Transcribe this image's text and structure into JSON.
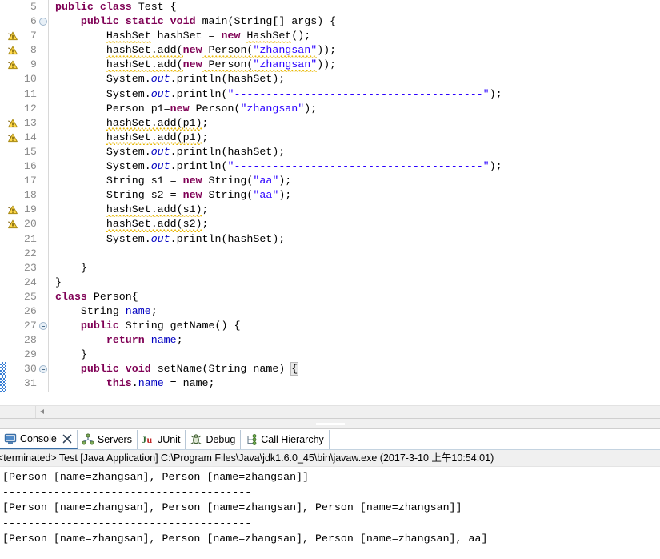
{
  "editor": {
    "language": "java",
    "first_visible_line": 5,
    "lines": [
      {
        "num": 5,
        "marker": "none",
        "fold": "none",
        "change": false,
        "tokens": [
          {
            "t": "public",
            "c": "kw"
          },
          {
            "t": " ",
            "c": "plain"
          },
          {
            "t": "class",
            "c": "kw"
          },
          {
            "t": " Test {",
            "c": "plain"
          }
        ]
      },
      {
        "num": 6,
        "marker": "none",
        "fold": "collapse",
        "change": false,
        "tokens": [
          {
            "t": "    ",
            "c": "plain"
          },
          {
            "t": "public",
            "c": "kw"
          },
          {
            "t": " ",
            "c": "plain"
          },
          {
            "t": "static",
            "c": "kw"
          },
          {
            "t": " ",
            "c": "plain"
          },
          {
            "t": "void",
            "c": "kw"
          },
          {
            "t": " main(String[] args) {",
            "c": "plain"
          }
        ]
      },
      {
        "num": 7,
        "marker": "warning",
        "fold": "none",
        "change": false,
        "tokens": [
          {
            "t": "        ",
            "c": "plain"
          },
          {
            "t": "HashSet",
            "c": "plain",
            "sq": true
          },
          {
            "t": " hashSet = ",
            "c": "plain"
          },
          {
            "t": "new",
            "c": "kw"
          },
          {
            "t": " ",
            "c": "plain"
          },
          {
            "t": "HashSet",
            "c": "plain",
            "sq": true
          },
          {
            "t": "();",
            "c": "plain"
          }
        ]
      },
      {
        "num": 8,
        "marker": "warning",
        "fold": "none",
        "change": false,
        "tokens": [
          {
            "t": "        ",
            "c": "plain"
          },
          {
            "t": "hashSet.add(",
            "c": "plain",
            "sq": true
          },
          {
            "t": "new",
            "c": "kw"
          },
          {
            "t": " Person(",
            "c": "plain",
            "sq": true
          },
          {
            "t": "\"zhangsan\"",
            "c": "str",
            "sq": true
          },
          {
            "t": "));",
            "c": "plain"
          }
        ]
      },
      {
        "num": 9,
        "marker": "warning",
        "fold": "none",
        "change": false,
        "tokens": [
          {
            "t": "        ",
            "c": "plain"
          },
          {
            "t": "hashSet.add(",
            "c": "plain",
            "sq": true
          },
          {
            "t": "new",
            "c": "kw"
          },
          {
            "t": " Person(",
            "c": "plain",
            "sq": true
          },
          {
            "t": "\"zhangsan\"",
            "c": "str",
            "sq": true
          },
          {
            "t": "));",
            "c": "plain"
          }
        ]
      },
      {
        "num": 10,
        "marker": "none",
        "fold": "none",
        "change": false,
        "tokens": [
          {
            "t": "        System.",
            "c": "plain"
          },
          {
            "t": "out",
            "c": "fld-static"
          },
          {
            "t": ".println(hashSet);",
            "c": "plain"
          }
        ]
      },
      {
        "num": 11,
        "marker": "none",
        "fold": "none",
        "change": false,
        "tokens": [
          {
            "t": "        System.",
            "c": "plain"
          },
          {
            "t": "out",
            "c": "fld-static"
          },
          {
            "t": ".println(",
            "c": "plain"
          },
          {
            "t": "\"---------------------------------------\"",
            "c": "str"
          },
          {
            "t": ");",
            "c": "plain"
          }
        ]
      },
      {
        "num": 12,
        "marker": "none",
        "fold": "none",
        "change": false,
        "tokens": [
          {
            "t": "        Person p1=",
            "c": "plain"
          },
          {
            "t": "new",
            "c": "kw"
          },
          {
            "t": " Person(",
            "c": "plain"
          },
          {
            "t": "\"zhangsan\"",
            "c": "str"
          },
          {
            "t": ");",
            "c": "plain"
          }
        ]
      },
      {
        "num": 13,
        "marker": "warning",
        "fold": "none",
        "change": false,
        "tokens": [
          {
            "t": "        ",
            "c": "plain"
          },
          {
            "t": "hashSet.add(p1)",
            "c": "plain",
            "sq": true
          },
          {
            "t": ";",
            "c": "plain"
          }
        ]
      },
      {
        "num": 14,
        "marker": "warning",
        "fold": "none",
        "change": false,
        "tokens": [
          {
            "t": "        ",
            "c": "plain"
          },
          {
            "t": "hashSet.add(p1)",
            "c": "plain",
            "sq": true
          },
          {
            "t": ";",
            "c": "plain"
          }
        ]
      },
      {
        "num": 15,
        "marker": "none",
        "fold": "none",
        "change": false,
        "tokens": [
          {
            "t": "        System.",
            "c": "plain"
          },
          {
            "t": "out",
            "c": "fld-static"
          },
          {
            "t": ".println(hashSet);",
            "c": "plain"
          }
        ]
      },
      {
        "num": 16,
        "marker": "none",
        "fold": "none",
        "change": false,
        "tokens": [
          {
            "t": "        System.",
            "c": "plain"
          },
          {
            "t": "out",
            "c": "fld-static"
          },
          {
            "t": ".println(",
            "c": "plain"
          },
          {
            "t": "\"---------------------------------------\"",
            "c": "str"
          },
          {
            "t": ");",
            "c": "plain"
          }
        ]
      },
      {
        "num": 17,
        "marker": "none",
        "fold": "none",
        "change": false,
        "tokens": [
          {
            "t": "        String s1 = ",
            "c": "plain"
          },
          {
            "t": "new",
            "c": "kw"
          },
          {
            "t": " String(",
            "c": "plain"
          },
          {
            "t": "\"aa\"",
            "c": "str"
          },
          {
            "t": ");",
            "c": "plain"
          }
        ]
      },
      {
        "num": 18,
        "marker": "none",
        "fold": "none",
        "change": false,
        "tokens": [
          {
            "t": "        String s2 = ",
            "c": "plain"
          },
          {
            "t": "new",
            "c": "kw"
          },
          {
            "t": " String(",
            "c": "plain"
          },
          {
            "t": "\"aa\"",
            "c": "str"
          },
          {
            "t": ");",
            "c": "plain"
          }
        ]
      },
      {
        "num": 19,
        "marker": "warning",
        "fold": "none",
        "change": false,
        "tokens": [
          {
            "t": "        ",
            "c": "plain"
          },
          {
            "t": "hashSet.add(s1)",
            "c": "plain",
            "sq": true
          },
          {
            "t": ";",
            "c": "plain"
          }
        ]
      },
      {
        "num": 20,
        "marker": "warning",
        "fold": "none",
        "change": false,
        "tokens": [
          {
            "t": "        ",
            "c": "plain"
          },
          {
            "t": "hashSet.add(s2)",
            "c": "plain",
            "sq": true
          },
          {
            "t": ";",
            "c": "plain"
          }
        ]
      },
      {
        "num": 21,
        "marker": "none",
        "fold": "none",
        "change": false,
        "tokens": [
          {
            "t": "        System.",
            "c": "plain"
          },
          {
            "t": "out",
            "c": "fld-static"
          },
          {
            "t": ".println(hashSet);",
            "c": "plain"
          }
        ]
      },
      {
        "num": 22,
        "marker": "none",
        "fold": "none",
        "change": false,
        "tokens": [
          {
            "t": "",
            "c": "plain"
          }
        ]
      },
      {
        "num": 23,
        "marker": "none",
        "fold": "none",
        "change": false,
        "tokens": [
          {
            "t": "    }",
            "c": "plain"
          }
        ]
      },
      {
        "num": 24,
        "marker": "none",
        "fold": "none",
        "change": false,
        "tokens": [
          {
            "t": "}",
            "c": "plain"
          }
        ]
      },
      {
        "num": 25,
        "marker": "none",
        "fold": "none",
        "change": false,
        "tokens": [
          {
            "t": "class",
            "c": "kw"
          },
          {
            "t": " Person{",
            "c": "plain"
          }
        ]
      },
      {
        "num": 26,
        "marker": "none",
        "fold": "none",
        "change": false,
        "tokens": [
          {
            "t": "    String ",
            "c": "plain"
          },
          {
            "t": "name",
            "c": "fld"
          },
          {
            "t": ";",
            "c": "plain"
          }
        ]
      },
      {
        "num": 27,
        "marker": "none",
        "fold": "collapse",
        "change": false,
        "tokens": [
          {
            "t": "    ",
            "c": "plain"
          },
          {
            "t": "public",
            "c": "kw"
          },
          {
            "t": " String getName() {",
            "c": "plain"
          }
        ]
      },
      {
        "num": 28,
        "marker": "none",
        "fold": "none",
        "change": false,
        "tokens": [
          {
            "t": "        ",
            "c": "plain"
          },
          {
            "t": "return",
            "c": "kw"
          },
          {
            "t": " ",
            "c": "plain"
          },
          {
            "t": "name",
            "c": "fld"
          },
          {
            "t": ";",
            "c": "plain"
          }
        ]
      },
      {
        "num": 29,
        "marker": "none",
        "fold": "none",
        "change": false,
        "tokens": [
          {
            "t": "    }",
            "c": "plain"
          }
        ]
      },
      {
        "num": 30,
        "marker": "none",
        "fold": "collapse",
        "change": true,
        "tokens": [
          {
            "t": "    ",
            "c": "plain"
          },
          {
            "t": "public",
            "c": "kw"
          },
          {
            "t": " ",
            "c": "plain"
          },
          {
            "t": "void",
            "c": "kw"
          },
          {
            "t": " setName(String name) ",
            "c": "plain"
          },
          {
            "t": "{",
            "c": "plain",
            "hl": true
          }
        ]
      },
      {
        "num": 31,
        "marker": "none",
        "fold": "none",
        "change": true,
        "tokens": [
          {
            "t": "        ",
            "c": "plain"
          },
          {
            "t": "this",
            "c": "kw"
          },
          {
            "t": ".",
            "c": "plain"
          },
          {
            "t": "name",
            "c": "fld"
          },
          {
            "t": " = name;",
            "c": "plain"
          }
        ]
      }
    ],
    "colors": {
      "keyword": "#7F0055",
      "string": "#2A00FF",
      "field": "#0000C0",
      "line_number": "#888888",
      "warning_squiggle": "#E8B600",
      "change_bar": "#3A7FD5",
      "background": "#FFFFFF"
    },
    "horizontal_scrollbar": {
      "visible": true,
      "scroll_left_arrow": "◄"
    }
  },
  "bottom_panel": {
    "tabs": [
      {
        "label": "Console",
        "icon": "console-icon",
        "active": true,
        "closable": true
      },
      {
        "label": "Servers",
        "icon": "servers-icon",
        "active": false,
        "closable": false
      },
      {
        "label": "JUnit",
        "icon": "junit-icon",
        "active": false,
        "closable": false
      },
      {
        "label": "Debug",
        "icon": "debug-icon",
        "active": false,
        "closable": false
      },
      {
        "label": "Call Hierarchy",
        "icon": "call-hierarchy-icon",
        "active": false,
        "closable": false
      }
    ],
    "console": {
      "header": "<terminated> Test [Java Application] C:\\Program Files\\Java\\jdk1.6.0_45\\bin\\javaw.exe (2017-3-10 上午10:54:01)",
      "status": "<terminated>",
      "launch_name": "Test",
      "launch_type": "Java Application",
      "vm_path": "C:\\Program Files\\Java\\jdk1.6.0_45\\bin\\javaw.exe",
      "timestamp": "2017-3-10 上午10:54:01",
      "output_lines": [
        "[Person [name=zhangsan], Person [name=zhangsan]]",
        "---------------------------------------",
        "[Person [name=zhangsan], Person [name=zhangsan], Person [name=zhangsan]]",
        "---------------------------------------",
        "[Person [name=zhangsan], Person [name=zhangsan], Person [name=zhangsan], aa]"
      ]
    }
  }
}
